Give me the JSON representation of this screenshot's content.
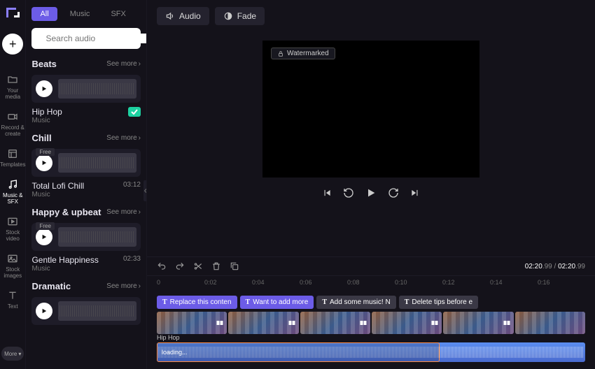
{
  "rail": {
    "items": [
      {
        "label": "Your media",
        "icon": "folder"
      },
      {
        "label": "Record & create",
        "icon": "camera"
      },
      {
        "label": "Templates",
        "icon": "template"
      },
      {
        "label": "Music & SFX",
        "icon": "music",
        "active": true
      },
      {
        "label": "Stock video",
        "icon": "video"
      },
      {
        "label": "Stock images",
        "icon": "image"
      },
      {
        "label": "Text",
        "icon": "text"
      }
    ],
    "more_label": "More"
  },
  "sidebar": {
    "tabs": [
      {
        "label": "All",
        "active": true
      },
      {
        "label": "Music"
      },
      {
        "label": "SFX"
      }
    ],
    "search": {
      "placeholder": "Search audio"
    },
    "categories": [
      {
        "title": "Beats",
        "see_more": "See more",
        "items": [
          {
            "name": "Hip Hop",
            "type": "Music",
            "duration": "",
            "free": false,
            "checked": true
          }
        ]
      },
      {
        "title": "Chill",
        "see_more": "See more",
        "items": [
          {
            "name": "Total Lofi Chill",
            "type": "Music",
            "duration": "03:12",
            "free": true
          }
        ]
      },
      {
        "title": "Happy & upbeat",
        "see_more": "See more",
        "items": [
          {
            "name": "Gentle Happiness",
            "type": "Music",
            "duration": "02:33",
            "free": true
          }
        ]
      },
      {
        "title": "Dramatic",
        "see_more": "See more",
        "items": [
          {
            "name": "",
            "type": "",
            "duration": ""
          }
        ]
      }
    ]
  },
  "toolbar": {
    "audio_label": "Audio",
    "fade_label": "Fade"
  },
  "preview": {
    "watermark": "Watermarked"
  },
  "timeline": {
    "current": "02:20",
    "current_frac": ".99",
    "total": "02:20",
    "total_frac": ".99",
    "ruler": [
      "0",
      "0:02",
      "0:04",
      "0:06",
      "0:08",
      "0:10",
      "0:12",
      "0:14",
      "0:16"
    ]
  },
  "text_chips": [
    {
      "label": "Replace this conten"
    },
    {
      "label": "Want to add more "
    },
    {
      "label": "Add some music! N",
      "grey": true
    },
    {
      "label": "Delete tips before e",
      "grey": true
    }
  ],
  "audio_track": {
    "name": "Hip Hop",
    "status": "loading..."
  }
}
